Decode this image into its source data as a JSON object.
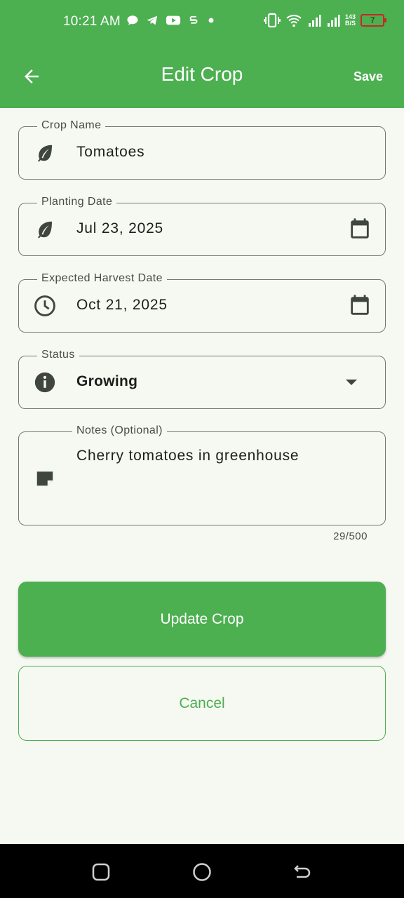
{
  "status_bar": {
    "time": "10:21 AM",
    "net_speed_value": "143",
    "net_speed_unit": "B/S",
    "battery_level": "7",
    "left_icons": [
      "chat-bubble-icon",
      "telegram-icon",
      "youtube-icon",
      "s-app-icon",
      "dot-icon"
    ],
    "right_icons": [
      "vibrate-icon",
      "wifi-icon",
      "signal-icon",
      "signal-icon"
    ]
  },
  "app_bar": {
    "title": "Edit Crop",
    "save_label": "Save",
    "back_icon": "arrow-back-icon"
  },
  "form": {
    "crop_name": {
      "label": "Crop Name",
      "value": "Tomatoes",
      "icon": "leaf-icon"
    },
    "planting_date": {
      "label": "Planting Date",
      "value": "Jul 23, 2025",
      "icon": "leaf-icon",
      "trailing_icon": "calendar-icon"
    },
    "harvest_date": {
      "label": "Expected Harvest Date",
      "value": "Oct 21, 2025",
      "icon": "clock-icon",
      "trailing_icon": "calendar-icon"
    },
    "status": {
      "label": "Status",
      "value": "Growing",
      "icon": "info-icon",
      "trailing_icon": "dropdown-arrow-icon"
    },
    "notes": {
      "label": "Notes (Optional)",
      "value": "Cherry tomatoes in greenhouse",
      "icon": "note-icon",
      "counter": "29/500"
    }
  },
  "actions": {
    "update_label": "Update Crop",
    "cancel_label": "Cancel"
  },
  "colors": {
    "primary": "#4caf50",
    "background": "#f6f9f1",
    "icon": "#3f463d"
  }
}
